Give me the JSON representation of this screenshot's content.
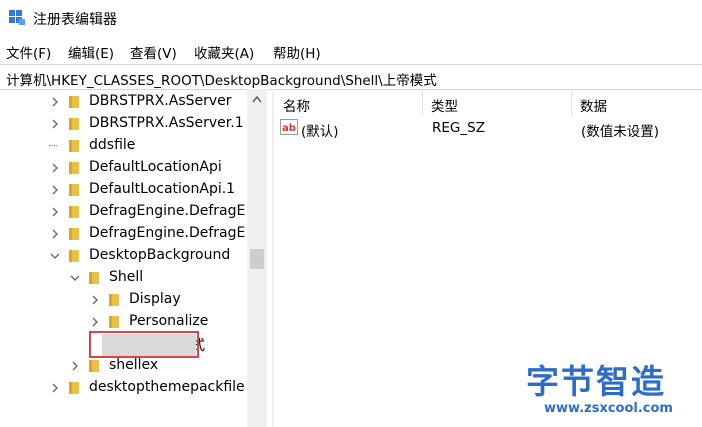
{
  "window": {
    "title": "注册表编辑器"
  },
  "menu": [
    "文件(F)",
    "编辑(E)",
    "查看(V)",
    "收藏夹(A)",
    "帮助(H)"
  ],
  "address": "计算机\\HKEY_CLASSES_ROOT\\DesktopBackground\\Shell\\上帝模式",
  "tree": {
    "items": [
      {
        "label": "DBRSTPRX.AsServer",
        "expanded": false
      },
      {
        "label": "DBRSTPRX.AsServer.1",
        "expanded": false
      },
      {
        "label": "ddsfile",
        "expanded": false
      },
      {
        "label": "DefaultLocationApi",
        "expanded": false
      },
      {
        "label": "DefaultLocationApi.1",
        "expanded": false
      },
      {
        "label": "DefragEngine.DefragE",
        "expanded": false
      },
      {
        "label": "DefragEngine.DefragE",
        "expanded": false
      },
      {
        "label": "DesktopBackground",
        "expanded": true
      },
      {
        "label": "Shell",
        "expanded": true
      },
      {
        "label": "Display",
        "expanded": false
      },
      {
        "label": "Personalize",
        "expanded": false
      },
      {
        "label": "上帝模式",
        "selected": true
      },
      {
        "label": "shellex",
        "expanded": false
      },
      {
        "label": "desktopthemepackfile",
        "expanded": false
      }
    ]
  },
  "list": {
    "columns": [
      "名称",
      "类型",
      "数据"
    ],
    "rows": [
      {
        "name": "(默认)",
        "type": "REG_SZ",
        "data": "(数值未设置)"
      }
    ]
  },
  "watermark": {
    "text": "字节智造",
    "url": "www.zsxcool.com"
  },
  "colors": {
    "folder": "#e8c04a",
    "folder_dark": "#d9a62a",
    "highlight": "#d9434a",
    "watermark": "#2d6ec4"
  }
}
